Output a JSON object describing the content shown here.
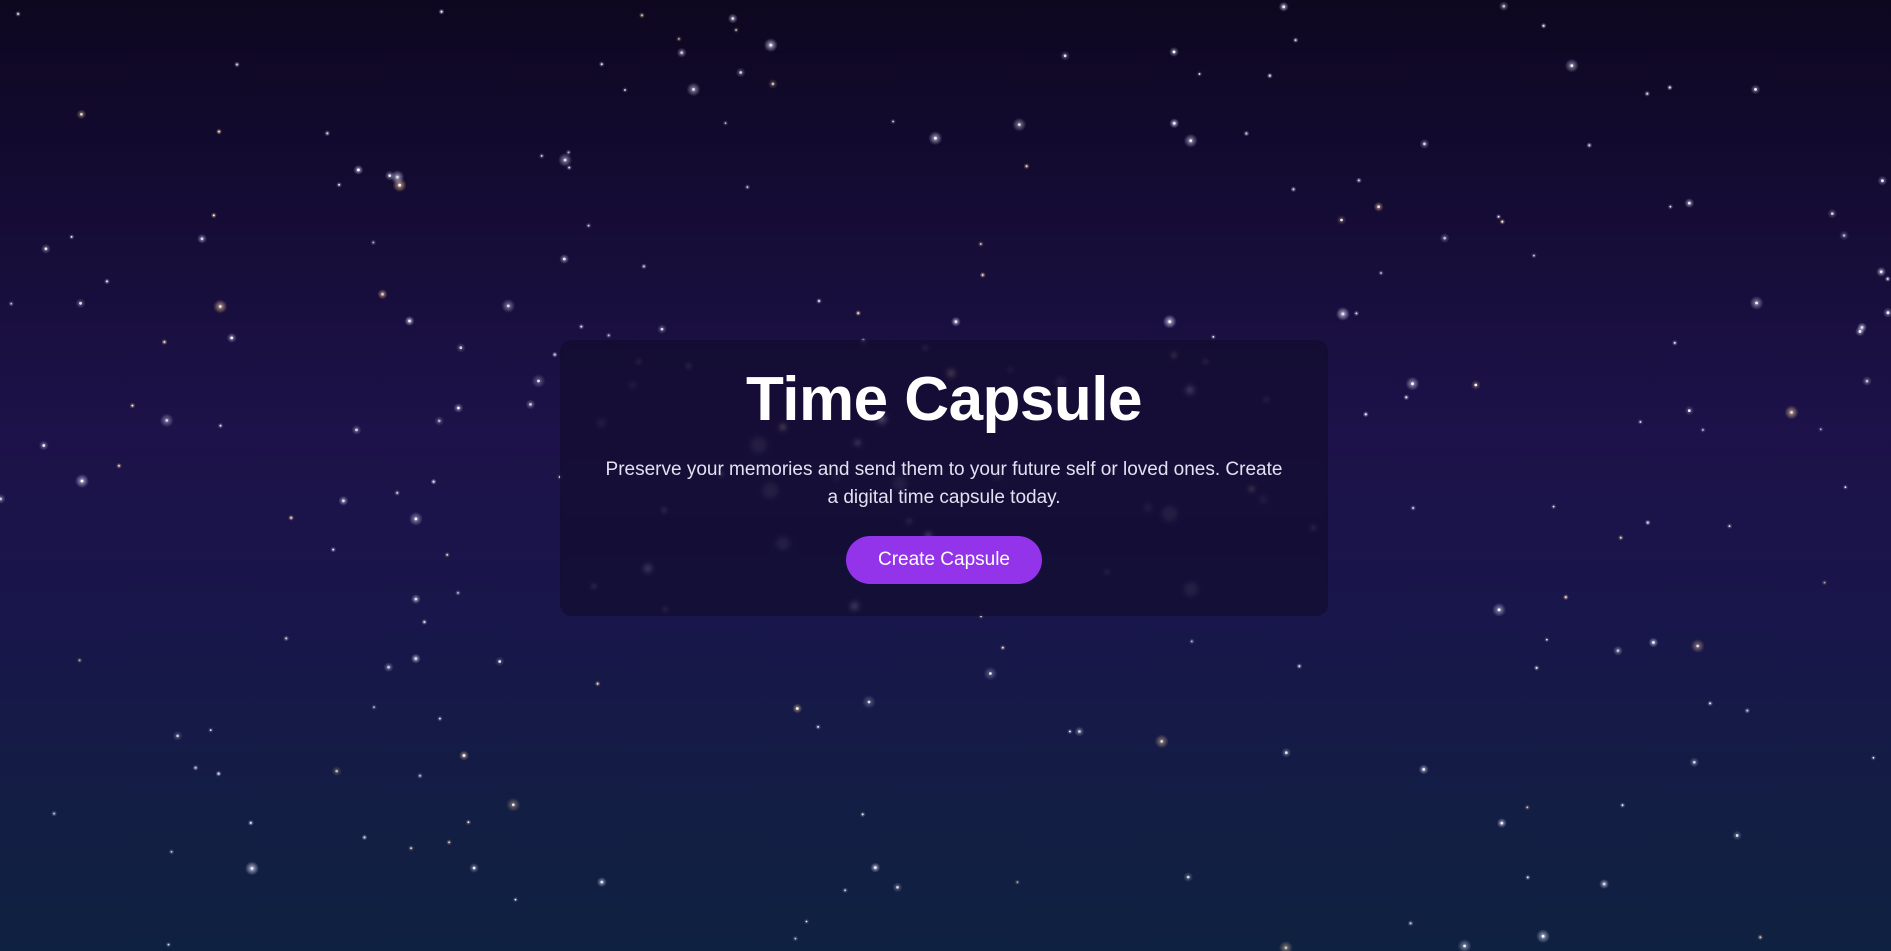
{
  "hero": {
    "title": "Time Capsule",
    "description": "Preserve your memories and send them to your future self or loved ones. Create a digital time capsule today.",
    "cta_label": "Create Capsule"
  },
  "theme": {
    "accent": "#9333ea",
    "background_top": "#0d0720",
    "background_bottom": "#0f2140",
    "star_color": "#ffffff",
    "star_warm_color": "#ffd9a8"
  }
}
